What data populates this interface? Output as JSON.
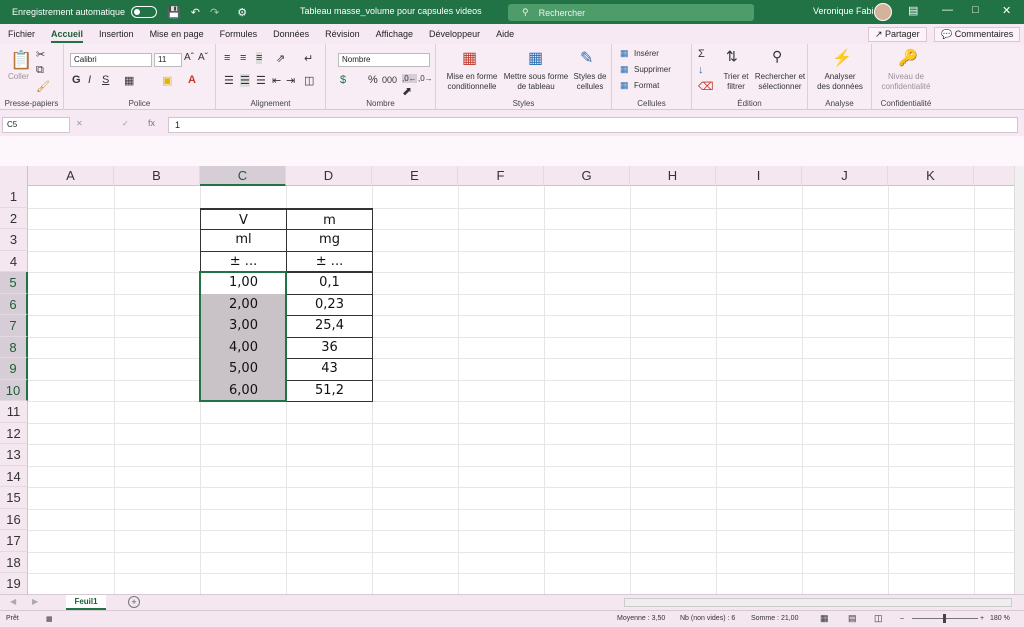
{
  "titlebar": {
    "autosave_label": "Enregistrement automatique",
    "doc_title": "Tableau masse_volume pour capsules videos",
    "search_placeholder": "Rechercher",
    "user_name": "Veronique Fabi"
  },
  "menu": {
    "tabs": [
      "Fichier",
      "Accueil",
      "Insertion",
      "Mise en page",
      "Formules",
      "Données",
      "Révision",
      "Affichage",
      "Développeur",
      "Aide"
    ],
    "active_tab": "Accueil",
    "share_label": "Partager",
    "comments_label": "Commentaires"
  },
  "ribbon": {
    "clipboard": {
      "paste": "Coller",
      "label": "Presse-papiers"
    },
    "font": {
      "name": "Calibri",
      "size": "11",
      "label": "Police"
    },
    "alignment": {
      "label": "Alignement"
    },
    "number": {
      "format": "Nombre",
      "label": "Nombre"
    },
    "styles": {
      "conditional": [
        "Mise en forme",
        "conditionnelle"
      ],
      "table": [
        "Mettre sous forme",
        "de tableau"
      ],
      "cell_styles": [
        "Styles de",
        "cellules"
      ],
      "label": "Styles"
    },
    "cells": {
      "insert": "Insérer",
      "delete": "Supprimer",
      "format": "Format",
      "label": "Cellules"
    },
    "editing": {
      "sort": [
        "Trier et",
        "filtrer"
      ],
      "find": [
        "Rechercher et",
        "sélectionner"
      ],
      "label": "Édition"
    },
    "analysis": {
      "analyze": [
        "Analyser",
        "des données"
      ],
      "label": "Analyse"
    },
    "sensitivity": {
      "level": [
        "Niveau de",
        "confidentialité"
      ],
      "label": "Confidentialité"
    }
  },
  "formula_bar": {
    "name_box": "C5",
    "fx": "fx",
    "value": "1"
  },
  "grid": {
    "columns": [
      "A",
      "B",
      "C",
      "D",
      "E",
      "F",
      "G",
      "H",
      "I",
      "J",
      "K"
    ],
    "rows": [
      "1",
      "2",
      "3",
      "4",
      "5",
      "6",
      "7",
      "8",
      "9",
      "10",
      "11",
      "12",
      "13",
      "14",
      "15",
      "16",
      "17",
      "18",
      "19"
    ],
    "table": {
      "headers": [
        [
          "V",
          "m"
        ],
        [
          "ml",
          "mg"
        ],
        [
          "± ...",
          "± ..."
        ]
      ],
      "data": [
        [
          "1,00",
          "0,1"
        ],
        [
          "2,00",
          "0,23"
        ],
        [
          "3,00",
          "25,4"
        ],
        [
          "4,00",
          "36"
        ],
        [
          "5,00",
          "43"
        ],
        [
          "6,00",
          "51,2"
        ]
      ]
    }
  },
  "sheets": {
    "active": "Feuil1"
  },
  "status": {
    "ready": "Prêt",
    "average": "Moyenne : 3,50",
    "count": "Nb (non vides) : 6",
    "sum": "Somme : 21,00",
    "zoom": "180 %"
  },
  "colors": {
    "accent": "#217346",
    "selection_fill": "#c9c3c8"
  }
}
